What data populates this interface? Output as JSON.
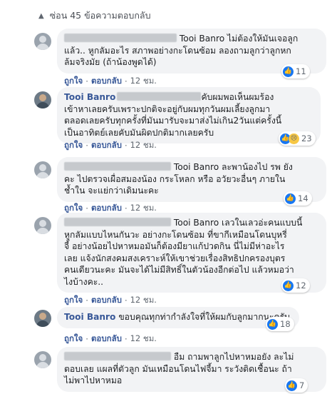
{
  "hide_replies": "ซ่อน 45 ข้อความตอบกลับ",
  "actions": {
    "like": "ถูกใจ",
    "reply": "ตอบกลับ"
  },
  "comments": [
    {
      "line1_after_blur": "Tooi Banro ไม่ต้องให้มันเจอลูก",
      "line2": "แล้ว.. หูกลัมอะไร สภาพอย่างกะโดนซ้อม ลองถามลูกว่าลูกหก",
      "line3": "ล้มจริงมัย (ถ้าน้องพูดได้)",
      "time": "12 ชม.",
      "reactions": "11"
    },
    {
      "author": "Tooi Banro",
      "line1_after_blur": "คับผมพอเห็นผมร้อง",
      "line2": "เข้าหาเลยครับเพราะปกติจะอยู่กับผมทุกวันผมเลี้ยงลูกมา",
      "line3": "ตลอดเลยครับทุกครั้งที่มันมารับจะมาส่งไม่เกิน2วันแต่ครั้งนี้",
      "line4": "เป็นอาทิตย์เลยคับมันผิดปกติมากเลยครับ",
      "time": "12 ชม.",
      "reactions": "23"
    },
    {
      "line1_after_blur": "Tooi Banro ละพาน้องไป รพ ยัง",
      "line2": "คะ ไปตรวจเผื่อสมองน้อง กระโหลก หรือ อวัยวะอื่นๆ ภายใน",
      "line3": "ช้ำใน จะแย่กว่าเดิมนะคะ",
      "time": "12 ชม.",
      "reactions": "14"
    },
    {
      "line1_after_blur": "Tooi Banro เลวในเลวอ่ะคนแบบนี้",
      "line2": "หูกลัมแบบไหนกันวะ อย่างกะโดนซ้อม ที่ขากีเหมือนโดนบุหรี่",
      "line3": "จี้ อย่างน้อยไปหาหมอมันก็ต้องมียาแก้ปวดกิน นี่ไม่มีห่าอะไร",
      "line4": "เลย แจ้งนักสงคมสงเคราะห์ให้เขาช่วยเรื่องสิทธิปกครองบุตร",
      "line5": "คนเดียวนะคะ มันจะได้ไม่มีสิทธิ์ในตัวน้องอีกต่อไป แล้วหมอว่า",
      "line6": "ไงบ้างคะ..",
      "time": "12 ชม.",
      "reactions": "12"
    },
    {
      "author": "Tooi Banro",
      "text": "ขอบคุณทุกท่ากำลังใจที่ให้ผมกับลูกมากนะครับ",
      "time": "12 ชม.",
      "reactions": "18"
    },
    {
      "line1_after_blur": "อืม ถามพาลูกไปหาหมอยัง ละไม่",
      "line2": "ตอบเลย แผลที่ตัวลูก มันเหมือนโดนไฟจี้มา ระวังติดเชื้อนะ ถ้า",
      "line3": "ไม่พาไปหาหมอ",
      "reactions": "7"
    }
  ]
}
